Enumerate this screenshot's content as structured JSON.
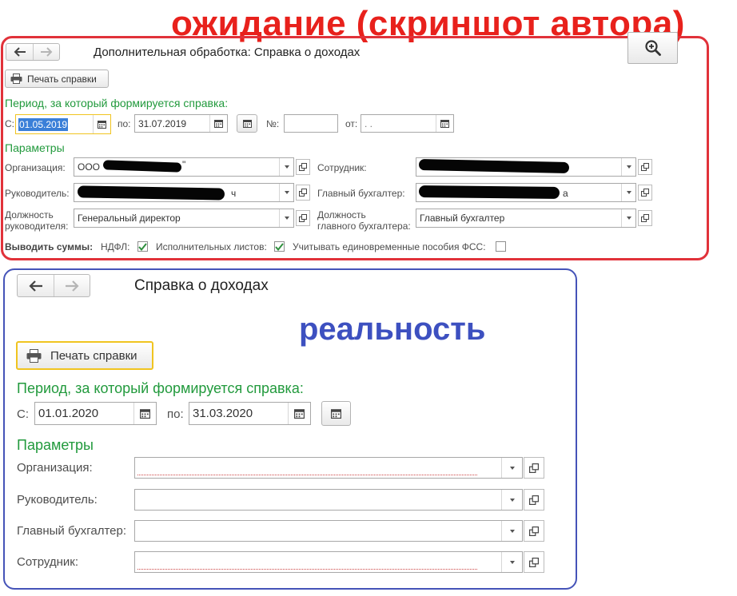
{
  "annotations": {
    "expected": "ожидание (скриншот автора)",
    "reality": "реальность"
  },
  "expected": {
    "title": "Дополнительная обработка: Справка о доходах",
    "print_button": "Печать справки",
    "period_heading": "Период, за который формируется справка:",
    "from_label": "С:",
    "from_value": "01.05.2019",
    "to_label": "по:",
    "to_value": "31.07.2019",
    "number_label": "№:",
    "number_value": "",
    "date_label": "от:",
    "date_value": " .  .",
    "params_heading": "Параметры",
    "organization_label": "Организация:",
    "organization_value": "ООО",
    "organization_tail": "\"",
    "employee_label": "Сотрудник:",
    "manager_label": "Руководитель:",
    "manager_tail": "ч",
    "chief_accountant_label": "Главный бухгалтер:",
    "chief_accountant_tail": "а",
    "manager_position_label_1": "Должность",
    "manager_position_label_2": "руководителя:",
    "manager_position_value": "Генеральный директор",
    "accountant_position_label_1": "Должность",
    "accountant_position_label_2": "главного бухгалтера:",
    "accountant_position_value": "Главный бухгалтер",
    "output_sums_label": "Выводить суммы:",
    "ndfl_label": "НДФЛ:",
    "ndfl_checked": true,
    "writs_label": "Исполнительных листов:",
    "writs_checked": true,
    "fss_label": "Учитывать единовременные пособия ФСС:",
    "fss_checked": false
  },
  "reality": {
    "title": "Справка о доходах",
    "print_button": "Печать справки",
    "period_heading": "Период, за который формируется справка:",
    "from_label": "С:",
    "from_value": "01.01.2020",
    "to_label": "по:",
    "to_value": "31.03.2020",
    "params_heading": "Параметры",
    "organization_label": "Организация:",
    "manager_label": "Руководитель:",
    "chief_accountant_label": "Главный бухгалтер:",
    "employee_label": "Сотрудник:"
  },
  "icons": {
    "back": "arrow-left-icon",
    "forward": "arrow-right-icon",
    "zoom": "zoom-in-icon",
    "print": "printer-icon",
    "calendar": "calendar-icon",
    "dropdown": "chevron-down-icon",
    "open": "open-form-icon",
    "check": "checkmark-icon"
  },
  "colors": {
    "annotation_red": "#e8211c",
    "annotation_blue": "#3d50c0",
    "heading_green": "#229a3d",
    "focus_yellow": "#f0c420",
    "selection_blue": "#3a7fd8",
    "checkbox_green": "#2f8f3e"
  }
}
